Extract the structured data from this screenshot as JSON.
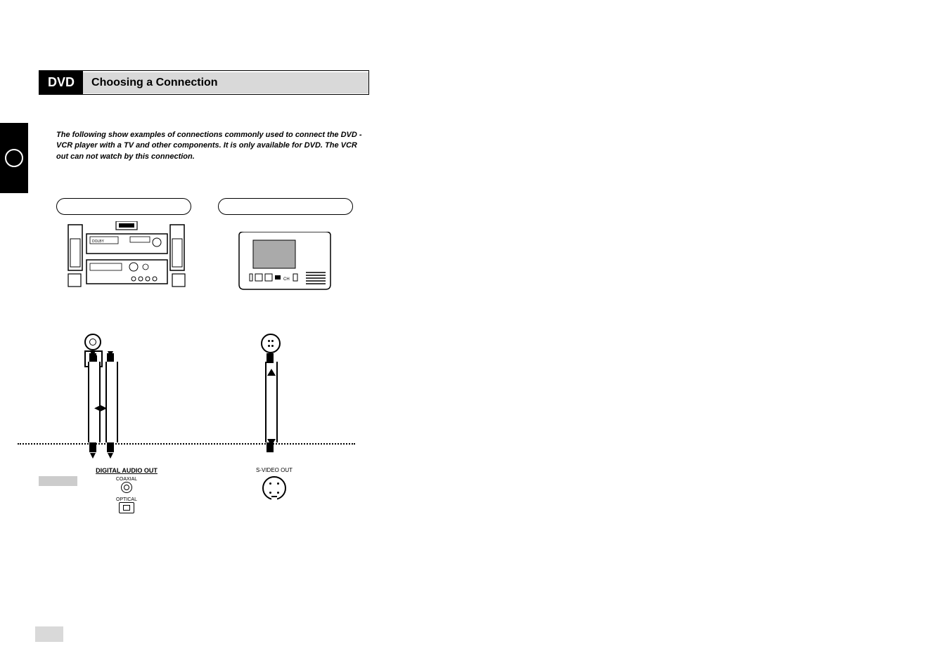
{
  "header": {
    "category": "DVD",
    "title": "Choosing a Connection"
  },
  "intro": "The following show examples of connections commonly used to connect the DVD -VCR player with a TV and other components. It is only available for DVD. The VCR out can not watch by this connection.",
  "diagram": {
    "method_a": "",
    "method_b": "",
    "digital_audio_out_label": "DIGITAL AUDIO OUT",
    "coaxial_label": "COAXIAL",
    "optical_label": "OPTICAL",
    "s_video_out_label": "S-VIDEO OUT"
  },
  "page_number": ""
}
